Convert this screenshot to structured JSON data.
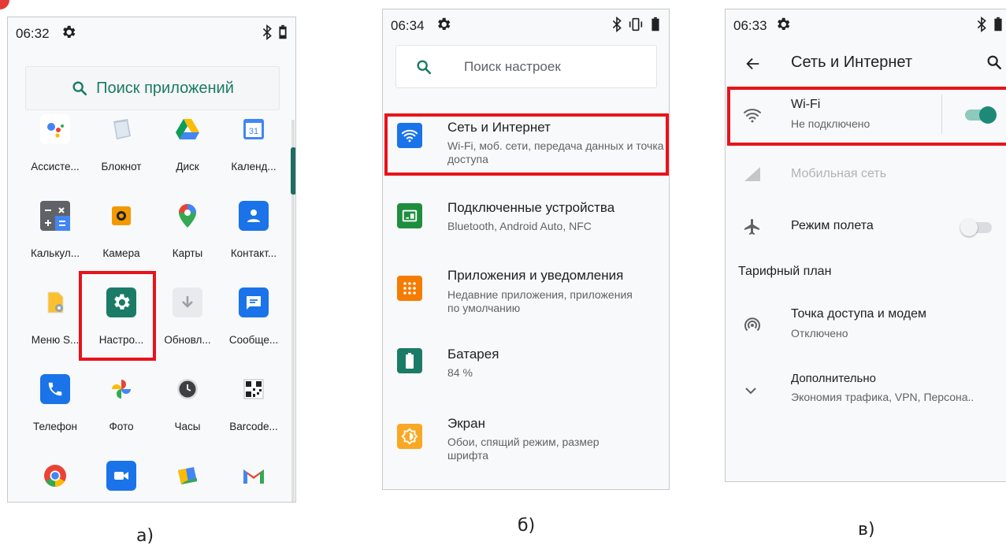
{
  "panels": {
    "a": {
      "time": "06:32",
      "search_label": "Поиск приложений",
      "apps": [
        {
          "label": "Ассисте...",
          "icon": "assistant-icon"
        },
        {
          "label": "Блокнот",
          "icon": "notepad-icon"
        },
        {
          "label": "Диск",
          "icon": "drive-icon"
        },
        {
          "label": "Календ...",
          "icon": "calendar-icon",
          "icon_text": "31"
        },
        {
          "label": "Калькул...",
          "icon": "calculator-icon"
        },
        {
          "label": "Камера",
          "icon": "camera-icon"
        },
        {
          "label": "Карты",
          "icon": "maps-icon"
        },
        {
          "label": "Контакт...",
          "icon": "contacts-icon"
        },
        {
          "label": "Меню S...",
          "icon": "menu-s-icon"
        },
        {
          "label": "Настро...",
          "icon": "settings-gear-icon"
        },
        {
          "label": "Обновл...",
          "icon": "update-download-icon"
        },
        {
          "label": "Сообще...",
          "icon": "messages-icon"
        },
        {
          "label": "Телефон",
          "icon": "phone-icon"
        },
        {
          "label": "Фото",
          "icon": "photos-icon"
        },
        {
          "label": "Часы",
          "icon": "clock-icon"
        },
        {
          "label": "Barcode...",
          "icon": "barcode-icon"
        },
        {
          "label": "",
          "icon": "chrome-icon"
        },
        {
          "label": "",
          "icon": "duo-icon"
        },
        {
          "label": "",
          "icon": "files-icon"
        },
        {
          "label": "",
          "icon": "gmail-icon"
        }
      ],
      "caption": "a)"
    },
    "b": {
      "time": "06:34",
      "search_placeholder": "Поиск настроек",
      "items": [
        {
          "title": "Сеть и Интернет",
          "subtitle": "Wi-Fi, моб. сети, передача данных и точка доступа",
          "icon": "wifi-icon",
          "color": "#1a73e8"
        },
        {
          "title": "Подключенные устройства",
          "subtitle": "Bluetooth, Android Auto, NFC",
          "icon": "connected-devices-icon",
          "color": "#1e8e3e"
        },
        {
          "title": "Приложения и уведомления",
          "subtitle": "Недавние приложения, приложения по умолчанию",
          "icon": "apps-grid-icon",
          "color": "#f57c00"
        },
        {
          "title": "Батарея",
          "subtitle": "84 %",
          "icon": "battery-icon",
          "color": "#1a7b66"
        },
        {
          "title": "Экран",
          "subtitle": "Обои, спящий режим, размер шрифта",
          "icon": "brightness-icon",
          "color": "#f9a825"
        }
      ],
      "caption": "б)"
    },
    "c": {
      "time": "06:33",
      "title": "Сеть и Интернет",
      "wifi": {
        "title": "Wi-Fi",
        "subtitle": "Не подключено",
        "enabled": true
      },
      "mobile": {
        "title": "Мобильная сеть"
      },
      "airplane": {
        "title": "Режим полета",
        "enabled": false
      },
      "tariff": {
        "title": "Тарифный план"
      },
      "hotspot": {
        "title": "Точка доступа и модем",
        "subtitle": "Отключено"
      },
      "advanced": {
        "title": "Дополнительно",
        "subtitle": "Экономия трафика, VPN, Персона.."
      },
      "caption": "в)"
    }
  },
  "colors": {
    "accent": "#1a7b66",
    "highlight": "#e8131b",
    "toggle_on": "#1d8a78"
  }
}
